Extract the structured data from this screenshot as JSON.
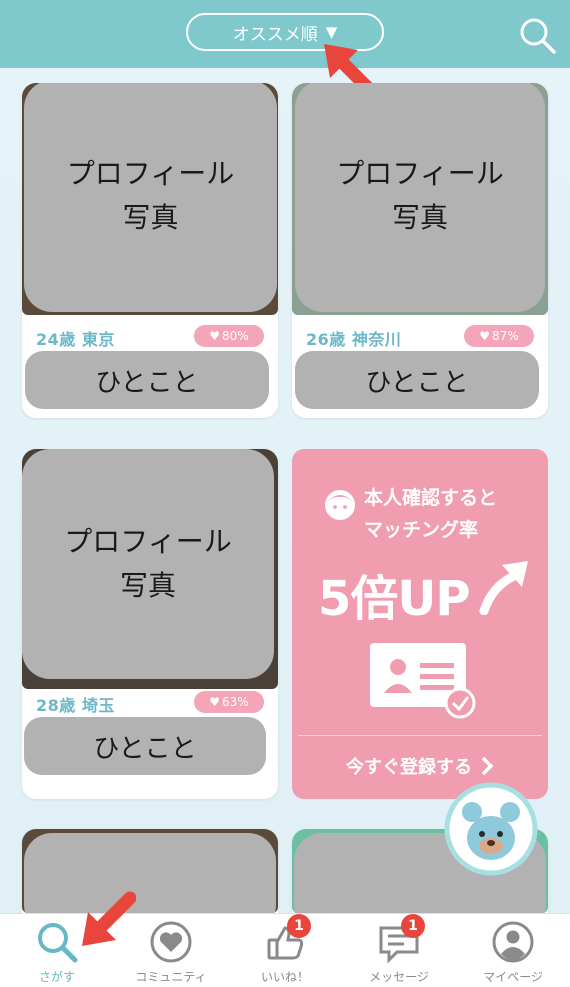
{
  "header": {
    "sort_label": "オススメ順",
    "sort_caret": "▼",
    "search_icon": "search-icon"
  },
  "cards": [
    {
      "photo": "プロフィール\n写真",
      "age_loc": "24歳  東京",
      "match": "80%",
      "hitokoto": "ひとこと"
    },
    {
      "photo": "プロフィール\n写真",
      "age_loc": "26歳  神奈川",
      "match": "87%",
      "hitokoto": "ひとこと"
    },
    {
      "photo": "プロフィール\n写真",
      "age_loc": "28歳  埼玉",
      "match": "63%",
      "hitokoto": "ひとこと"
    }
  ],
  "promo": {
    "line1": "本人確認すると",
    "line2": "マッチング率",
    "big": "5倍UP",
    "cta": "今すぐ登録する"
  },
  "tabs": [
    {
      "label": "さがす",
      "icon": "search-icon",
      "active": true
    },
    {
      "label": "コミュニティ",
      "icon": "heart-icon"
    },
    {
      "label": "いいね！",
      "icon": "thumbs-up-icon",
      "badge": "1"
    },
    {
      "label": "メッセージ",
      "icon": "message-icon",
      "badge": "1"
    },
    {
      "label": "マイページ",
      "icon": "user-icon"
    }
  ],
  "colors": {
    "header": "#7fc8cc",
    "accent": "#67b8c4",
    "promo": "#f09db0",
    "match_badge": "#f4a5b8",
    "notification": "#e8453c",
    "annotation_arrow": "#e8453c"
  }
}
